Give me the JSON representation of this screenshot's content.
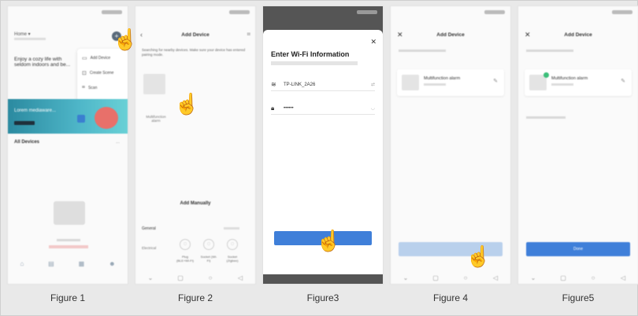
{
  "figure1": {
    "caption": "Figure 1",
    "status_time": "",
    "promo_text": "Enjoy a cozy life with seldom indoors and be...",
    "menu": [
      {
        "icon": "add-device-icon",
        "label": "Add Device"
      },
      {
        "icon": "create-scene-icon",
        "label": "Create Scene"
      },
      {
        "icon": "scan-icon",
        "label": "Scan"
      }
    ],
    "banner_text": "Lorem mediaware...",
    "all_devices": "All Devices",
    "more": "..."
  },
  "figure2": {
    "caption": "Figure 2",
    "title": "Add Device",
    "searching": "Searching for nearby devices. Make sure your device has entered pairing mode.",
    "device_label": "Multifunction alarm",
    "add_manually": "Add Manually",
    "general": "General",
    "category": "Electrical",
    "plugs": [
      "Plug (BLE+Wi-Fi)",
      "Socket (Wi-Fi)",
      "Socket (Zigbee)"
    ]
  },
  "figure3": {
    "caption": "Figure3",
    "title": "Enter Wi-Fi Information",
    "ssid": "TP-LINK_2A26",
    "password_mask": "••••••"
  },
  "figure4": {
    "caption": "Figure 4",
    "title": "Add Device",
    "device_name": "Multifunction alarm"
  },
  "figure5": {
    "caption": "Figure5",
    "title": "Add Device",
    "device_name": "Multifunction alarm",
    "done": "Done"
  }
}
